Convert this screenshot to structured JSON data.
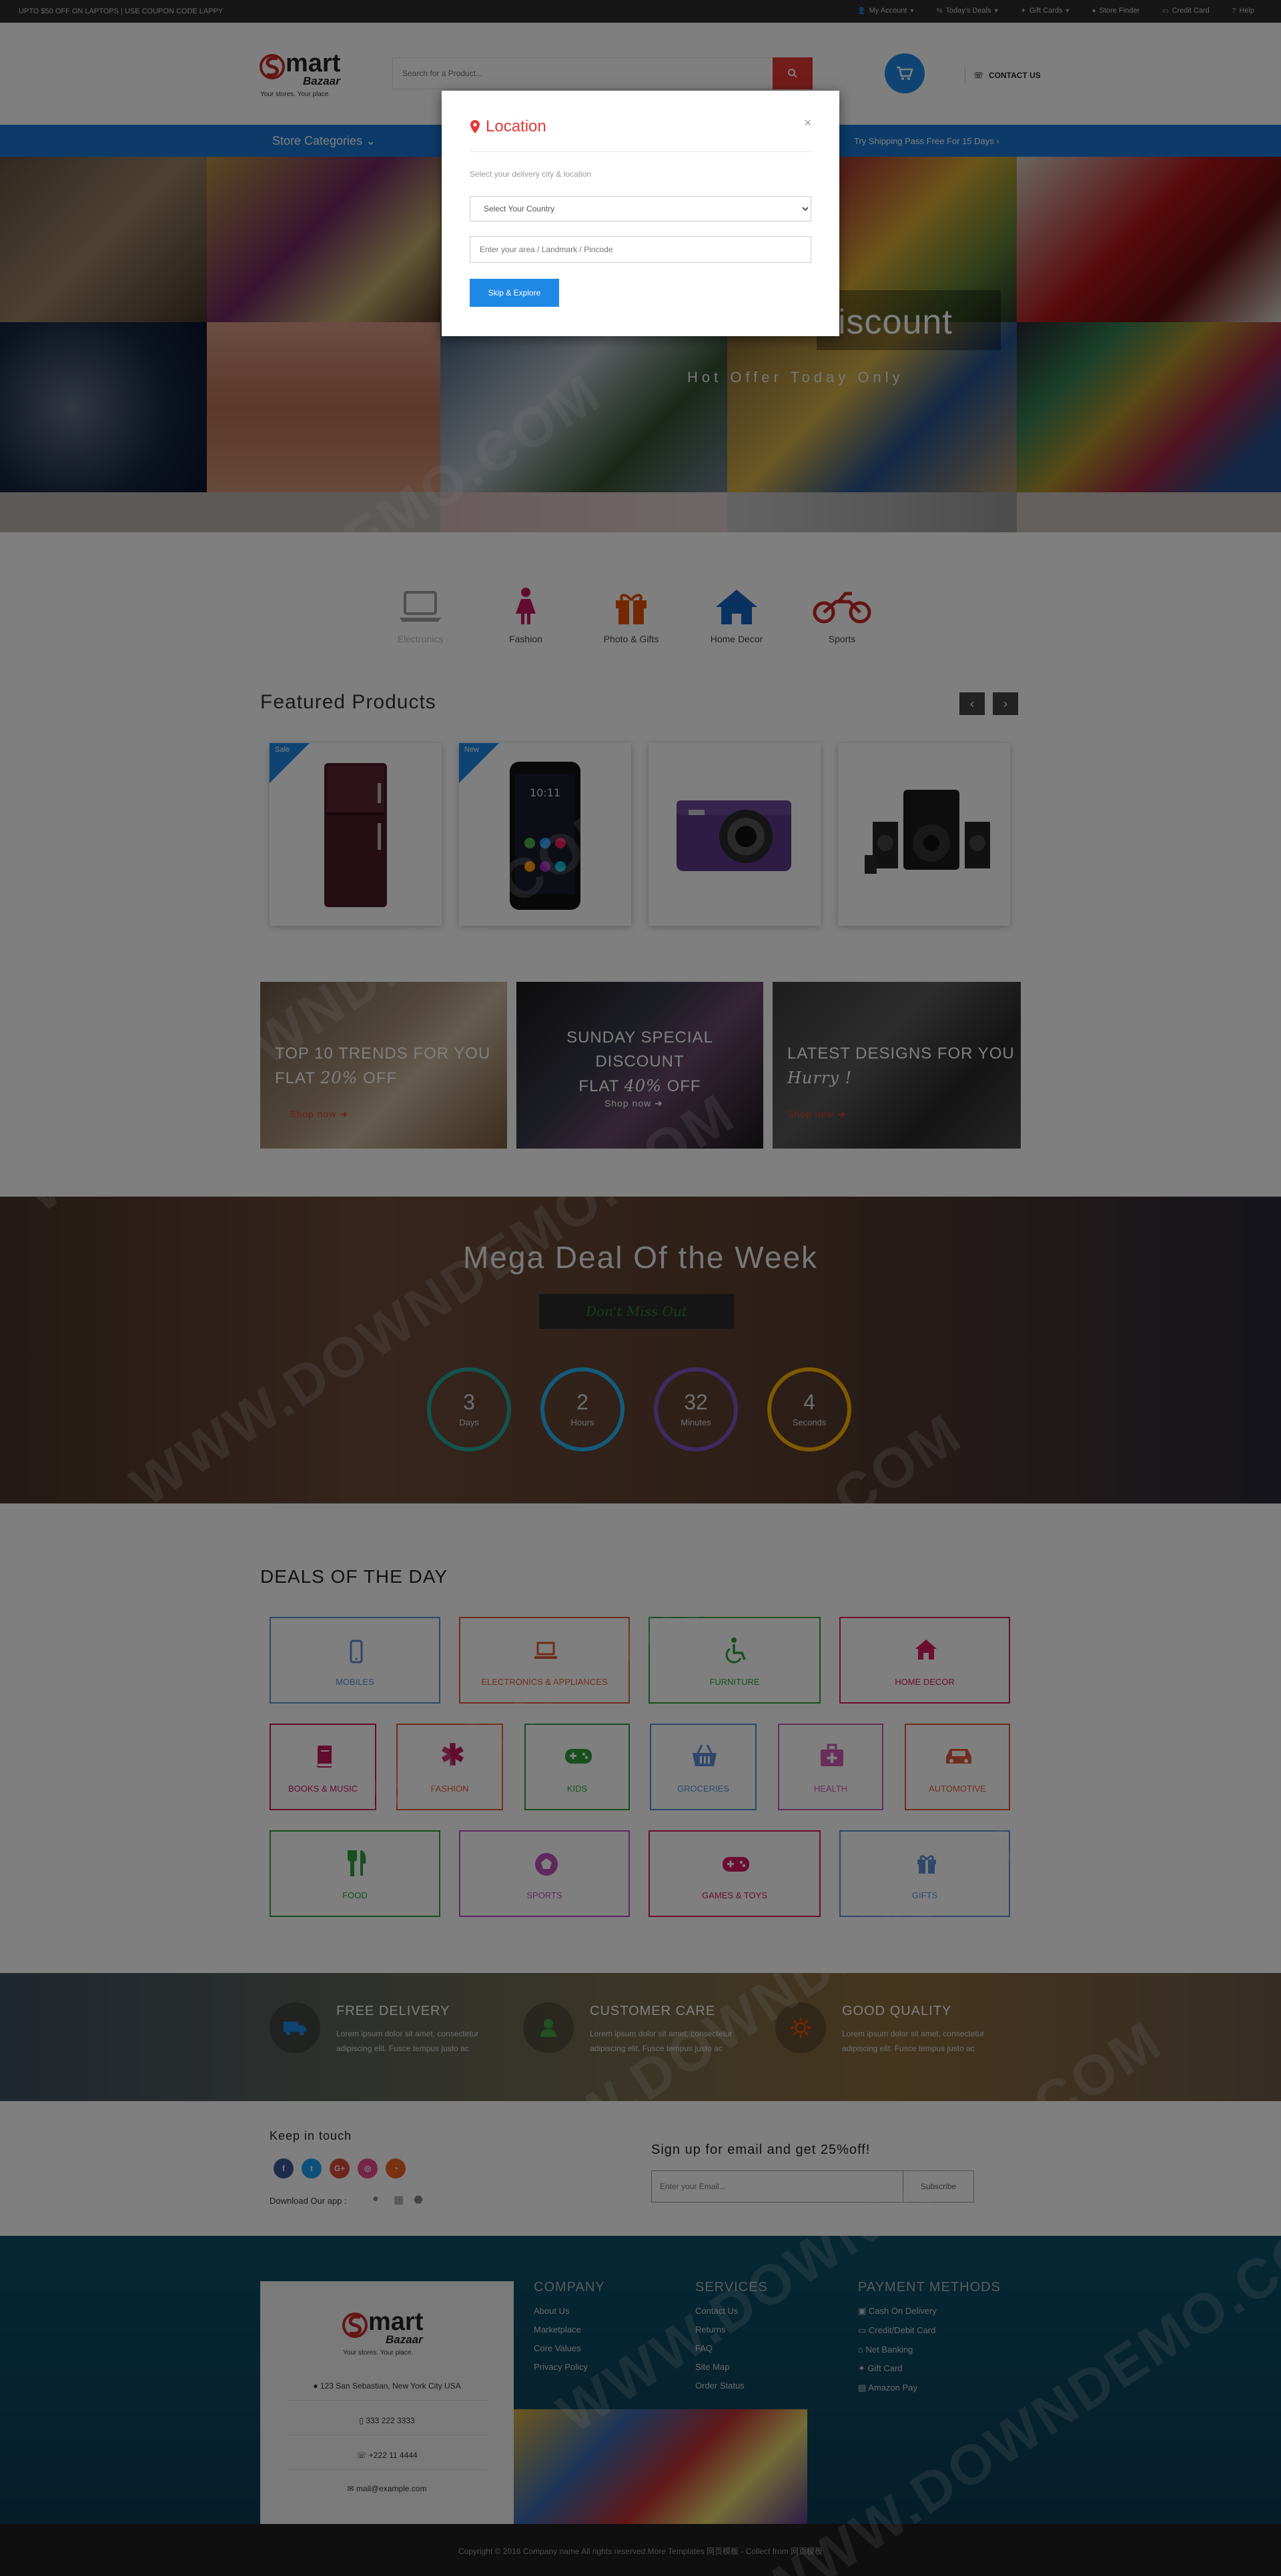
{
  "topbar": {
    "promo": "UPTO $50 OFF ON LAPTOPS | USE COUPON CODE LAPPY",
    "links": [
      "My Account",
      "Today's Deals",
      "Gift Cards",
      "Store Finder",
      "Credit Card",
      "Help"
    ]
  },
  "header": {
    "logo_word": "mart",
    "logo_word2": "Bazaar",
    "logo_tagline": "Your stores. Your place.",
    "search_placeholder": "Search for a Product...",
    "contact": "CONTACT US"
  },
  "nav": {
    "categories_label": "Store Categories",
    "shipping_promo": "Try Shipping Pass Free For 15 Days"
  },
  "banner": {
    "title": "iscount",
    "subtitle": "Hot Offer Today Only"
  },
  "categories": [
    {
      "label": "Electronics",
      "icon": "laptop-icon",
      "color": "#9e9e9e"
    },
    {
      "label": "Fashion",
      "icon": "female-icon",
      "color": "#c2185b"
    },
    {
      "label": "Photo & Gifts",
      "icon": "gift-icon",
      "color": "#e65100"
    },
    {
      "label": "Home Decor",
      "icon": "home-icon",
      "color": "#1565c0"
    },
    {
      "label": "Sports",
      "icon": "motorcycle-icon",
      "color": "#c62828"
    }
  ],
  "featured": {
    "title": "Featured Products",
    "products": [
      {
        "badge": "Sale",
        "name": "refrigerator"
      },
      {
        "badge": "New",
        "name": "smartphone"
      },
      {
        "badge": "",
        "name": "camera"
      },
      {
        "badge": "",
        "name": "speaker system"
      }
    ]
  },
  "promos": [
    {
      "line1": "TOP 10 TRENDS FOR YOU",
      "line2a": "FLAT ",
      "script": "20%",
      "line2b": " OFF",
      "shop": "Shop now"
    },
    {
      "line1": "SUNDAY SPECIAL DISCOUNT",
      "line2a": "FLAT ",
      "script": "40%",
      "line2b": " OFF",
      "shop": "Shop now"
    },
    {
      "line1": "LATEST DESIGNS FOR YOU",
      "line2a": "",
      "script": "Hurry !",
      "line2b": "",
      "shop": "Shop now"
    }
  ],
  "mega": {
    "title": "Mega Deal Of the Week",
    "button": "Don't Miss Out",
    "countdown": [
      {
        "value": "3",
        "unit": "Days",
        "color": "#26a69a"
      },
      {
        "value": "2",
        "unit": "Hours",
        "color": "#29b6f6"
      },
      {
        "value": "32",
        "unit": "Minutes",
        "color": "#7e57c2"
      },
      {
        "value": "4",
        "unit": "Seconds",
        "color": "#ffb300"
      }
    ]
  },
  "deals": {
    "title": "DEALS OF THE DAY",
    "row1": [
      {
        "label": "MOBILES",
        "color": "#5c8fd6",
        "icon": "mobile-icon"
      },
      {
        "label": "ELECTRONICS & APPLIANCES",
        "color": "#e05a3a",
        "icon": "laptop-icon"
      },
      {
        "label": "FURNITURE",
        "color": "#2e9e3e",
        "icon": "wheelchair-icon"
      },
      {
        "label": "HOME DECOR",
        "color": "#d81b60",
        "icon": "home-icon"
      }
    ],
    "row2": [
      {
        "label": "BOOKS & MUSIC",
        "color": "#c2185b",
        "icon": "book-icon"
      },
      {
        "label": "FASHION",
        "color": "#e05a3a",
        "icon": "asterisk-icon"
      },
      {
        "label": "KIDS",
        "color": "#2e9e3e",
        "icon": "gamepad-icon"
      },
      {
        "label": "GROCERIES",
        "color": "#5c8fd6",
        "icon": "basket-icon"
      },
      {
        "label": "HEALTH",
        "color": "#d05ab0",
        "icon": "medkit-icon"
      },
      {
        "label": "AUTOMOTIVE",
        "color": "#e05a3a",
        "icon": "car-icon"
      }
    ],
    "row3": [
      {
        "label": "FOOD",
        "color": "#2e9e3e",
        "icon": "cutlery-icon"
      },
      {
        "label": "SPORTS",
        "color": "#c050c0",
        "icon": "ball-icon"
      },
      {
        "label": "GAMES & TOYS",
        "color": "#d81b60",
        "icon": "gamepad-icon"
      },
      {
        "label": "GIFTS",
        "color": "#5c8fd6",
        "icon": "gift-icon"
      }
    ]
  },
  "services": [
    {
      "title": "FREE DELIVERY",
      "text": "Lorem ipsum dolor sit amet, consectetur adipiscing elit. Fusce tempus justo ac",
      "icon": "truck-icon",
      "color": "#1e88e5"
    },
    {
      "title": "CUSTOMER CARE",
      "text": "Lorem ipsum dolor sit amet, consectetur adipiscing elit. Fusce tempus justo ac",
      "icon": "user-icon",
      "color": "#43a047"
    },
    {
      "title": "GOOD QUALITY",
      "text": "Lorem ipsum dolor sit amet, consectetur adipiscing elit. Fusce tempus justo ac",
      "icon": "sun-icon",
      "color": "#e65100"
    }
  ],
  "newsletter": {
    "keep_in_touch": "Keep in touch",
    "download_app": "Download Our app :",
    "signup": "Sign up for email and get 25%off!",
    "email_placeholder": "Enter your Email...",
    "subscribe": "Subscribe",
    "socials": [
      {
        "name": "facebook",
        "glyph": "f",
        "color": "#3b5998"
      },
      {
        "name": "twitter",
        "glyph": "t",
        "color": "#1da1f2"
      },
      {
        "name": "google-plus",
        "glyph": "G+",
        "color": "#dd4b39"
      },
      {
        "name": "dribbble",
        "glyph": "◎",
        "color": "#ea4c89"
      },
      {
        "name": "rss",
        "glyph": "◔",
        "color": "#f26522"
      }
    ]
  },
  "footer": {
    "address": "123 San Sebastian, New York City USA",
    "phone1": "333 222 3333",
    "phone2": "+222 11 4444",
    "email": "mail@example.com",
    "company": {
      "title": "COMPANY",
      "items": [
        "About Us",
        "Marketplace",
        "Core Values",
        "Privacy Policy"
      ]
    },
    "services": {
      "title": "SERVICES",
      "items": [
        "Contact Us",
        "Returns",
        "FAQ",
        "Site Map",
        "Order Status"
      ]
    },
    "payment": {
      "title": "PAYMENT METHODS",
      "items": [
        "Cash On Delivery",
        "Credit/Debit Card",
        "Net Banking",
        "Gift Card",
        "Amazon Pay"
      ]
    },
    "copyright": "Copyright © 2016 Company name All rights reserved.More Templates 网页模板 - Collect from 网页模板"
  },
  "modal": {
    "title": "Location",
    "hint": "Select your delivery city & location",
    "country_select": "Select Your Country",
    "area_placeholder": "Enter your area / Landmark / Pincode",
    "skip_button": "Skip & Explore",
    "close": "×"
  },
  "watermark": "WWW.DOWNDEMO.COM"
}
